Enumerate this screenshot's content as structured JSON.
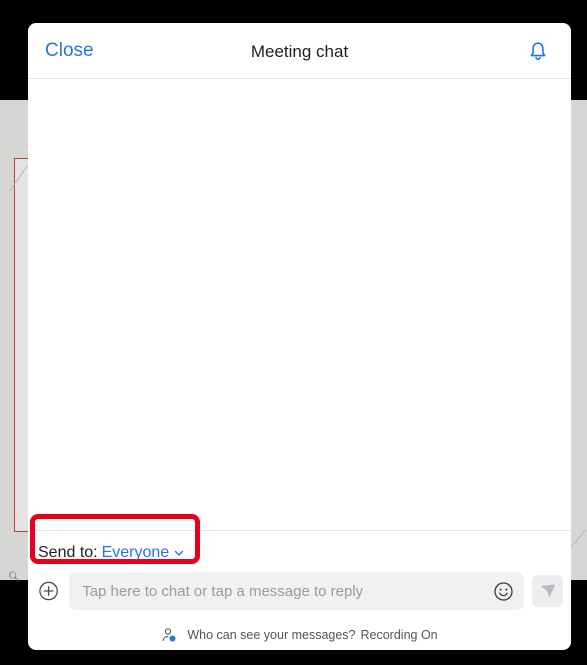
{
  "header": {
    "close_label": "Close",
    "title": "Meeting chat",
    "bell_icon": "bell-icon"
  },
  "compose": {
    "send_to_label": "Send to:",
    "send_to_value": "Everyone",
    "chat_placeholder": "Tap here to chat or tap a message to reply",
    "chat_value": "",
    "privacy_text": "Who can see your messages?",
    "recording_text": "Recording On"
  },
  "icons": {
    "plus": "plus-circle-icon",
    "emoji": "smiley-icon",
    "send": "send-icon",
    "privacy": "person-icon",
    "chevron": "chevron-down-icon"
  },
  "colors": {
    "accent": "#2a73e6",
    "highlight": "#e5001c"
  }
}
